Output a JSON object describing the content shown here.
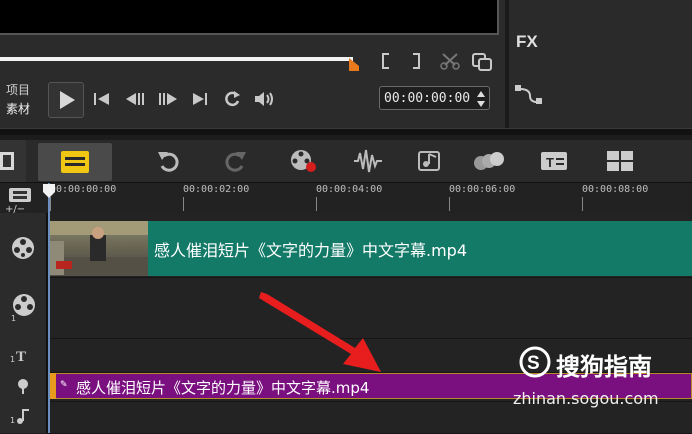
{
  "player": {
    "mode_project": "项目",
    "mode_clip": "素材",
    "timecode": "00:00:00:00",
    "scrub_progress": 0.51
  },
  "fx_panel": {
    "fx_label": "FX"
  },
  "timeline": {
    "ruler_ticks": [
      "00:00:00:00",
      "00:00:02:00",
      "00:00:04:00",
      "00:00:06:00",
      "00:00:08:00"
    ],
    "zoom_label": "+/−",
    "video_clip": {
      "name": "感人催泪短片《文字的力量》中文字幕.mp4"
    },
    "title_clip": {
      "name": "感人催泪短片《文字的力量》中文字幕.mp4"
    }
  },
  "watermark": {
    "brand": "搜狗指南",
    "url": "zhinan.sogou.com"
  },
  "colors": {
    "video_clip": "#137a68",
    "title_clip": "#7a0f80",
    "arrow": "#e81e1e",
    "handle": "#e87a1e"
  },
  "icons": {
    "toolbar": [
      "undo-icon",
      "redo-icon",
      "record-capture-icon",
      "audio-mix-icon",
      "auto-music-icon",
      "motion-track-icon",
      "subtitle-editor-icon",
      "multi-camera-icon"
    ],
    "player": [
      "play-icon",
      "home-icon",
      "prev-frame-icon",
      "next-frame-icon",
      "end-icon",
      "repeat-icon",
      "volume-icon",
      "mark-in-icon",
      "mark-out-icon",
      "split-icon",
      "copy-icon"
    ]
  }
}
